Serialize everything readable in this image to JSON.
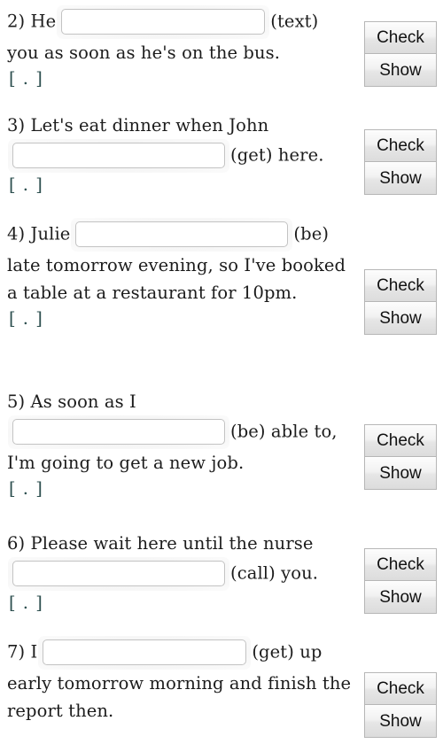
{
  "exercise": {
    "questions": [
      {
        "number": "2)",
        "text_before": "He",
        "input_value": "",
        "input_placeholder": "",
        "cue": "(text)",
        "text_after": "you as soon as he's on the bus.",
        "feedback": "[ . ]"
      },
      {
        "number": "3)",
        "text_before": "Let's eat dinner when John",
        "input_value": "",
        "input_placeholder": "",
        "cue": "(get) here.",
        "text_after": "",
        "feedback": "[ . ]"
      },
      {
        "number": "4)",
        "text_before": "Julie",
        "input_value": "",
        "input_placeholder": "",
        "cue": "(be)",
        "text_after": "late tomorrow evening, so I've booked a table at a restaurant for 10pm.",
        "feedback": "[ . ]"
      },
      {
        "number": "5)",
        "text_before": "As soon as I",
        "input_value": "",
        "input_placeholder": "",
        "cue": "(be) able to,",
        "text_after": "I'm going to get a new job.",
        "feedback": "[ . ]"
      },
      {
        "number": "6)",
        "text_before": "Please wait here until the nurse",
        "input_value": "",
        "input_placeholder": "",
        "cue": "(call) you.",
        "text_after": "",
        "feedback": "[ . ]"
      },
      {
        "number": "7)",
        "text_before": "I",
        "input_value": "",
        "input_placeholder": "",
        "cue": "(get) up",
        "text_after": "early tomorrow morning and finish the report then.",
        "feedback": ""
      }
    ],
    "buttons": {
      "check_label": "Check",
      "show_label": "Show"
    },
    "colors": {
      "feedback": "#2d4f4f",
      "text": "#1c1c1c",
      "button_face": "#eeeeee",
      "button_border": "#b6b6b6",
      "page_background": "#ffffff"
    }
  }
}
